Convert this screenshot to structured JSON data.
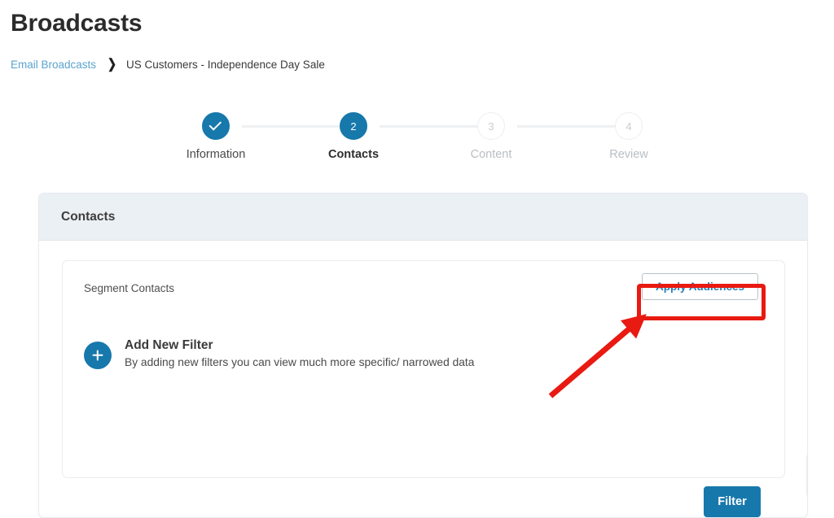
{
  "page": {
    "title": "Broadcasts"
  },
  "breadcrumb": {
    "link_label": "Email Broadcasts",
    "separator": "❯",
    "current": "US Customers - Independence Day Sale"
  },
  "stepper": {
    "steps": [
      {
        "number": "✓",
        "label": "Information",
        "state": "done"
      },
      {
        "number": "2",
        "label": "Contacts",
        "state": "active"
      },
      {
        "number": "3",
        "label": "Content",
        "state": "todo"
      },
      {
        "number": "4",
        "label": "Review",
        "state": "todo"
      }
    ]
  },
  "contacts_card": {
    "header_title": "Contacts",
    "segment_label": "Segment Contacts",
    "apply_audiences_label": "Apply Audiences",
    "add_filter": {
      "icon": "plus-icon",
      "title": "Add New Filter",
      "description": "By adding new filters you can view much more specific/ narrowed data"
    },
    "filter_button_label": "Filter"
  },
  "annotation": {
    "type": "red-highlight-with-arrow",
    "target": "Apply Audiences",
    "color": "#e81a11"
  },
  "colors": {
    "brand_blue": "#1778ac",
    "link_blue": "#5ba3cf",
    "card_header_bg": "#eaf0f3",
    "annotation_red": "#e81a11"
  }
}
